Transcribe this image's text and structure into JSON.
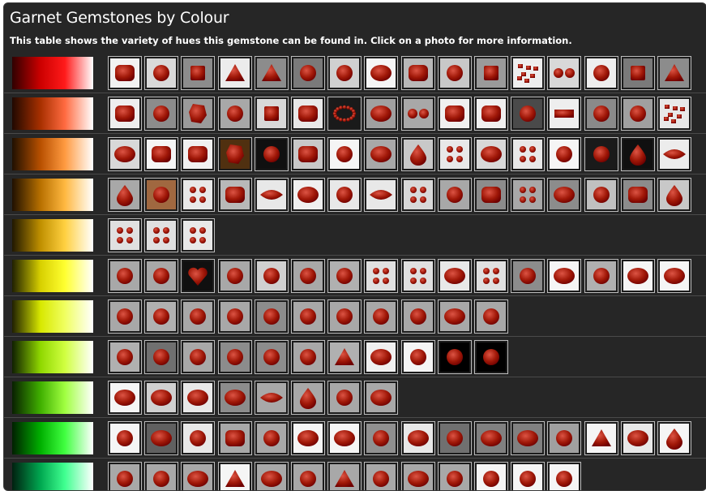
{
  "page": {
    "title": "Garnet Gemstones by Colour",
    "subtitle": "This table shows the variety of hues this gemstone can be found in. Click on a photo for more information."
  },
  "rows": [
    {
      "name": "red",
      "gradient": [
        "#300000",
        "#cc0000",
        "#ff1a1a",
        "#ffffff"
      ],
      "gems": [
        {
          "c": "#a01808",
          "s": "cushion",
          "bg": "#f2f2f2"
        },
        {
          "c": "#8a1a1a",
          "s": "round",
          "bg": "#d9d9d9"
        },
        {
          "c": "#a02010",
          "s": "square",
          "bg": "#8c8c8c"
        },
        {
          "c": "#6a0808",
          "s": "trillion",
          "bg": "#ececec"
        },
        {
          "c": "#8c1a10",
          "s": "trillion",
          "bg": "#8c8c8c"
        },
        {
          "c": "#b01010",
          "s": "round",
          "bg": "#7a7a7a"
        },
        {
          "c": "#a01818",
          "s": "round",
          "bg": "#d0d0d0"
        },
        {
          "c": "#b00808",
          "s": "oval",
          "bg": "#f5f5f5"
        },
        {
          "c": "#a81010",
          "s": "cushion",
          "bg": "#b8b8b8"
        },
        {
          "c": "#a01818",
          "s": "round",
          "bg": "#c8c8c8"
        },
        {
          "c": "#b01818",
          "s": "square",
          "bg": "#9a9a9a"
        },
        {
          "c": "#c02828",
          "s": "cluster",
          "bg": "#eeeeee"
        },
        {
          "c": "#b01818",
          "s": "pair",
          "bg": "#d8d8d8"
        },
        {
          "c": "#c03838",
          "s": "round",
          "bg": "#eeeeee"
        },
        {
          "c": "#901010",
          "s": "square",
          "bg": "#7a7a7a"
        },
        {
          "c": "#a01010",
          "s": "trillion",
          "bg": "#8c8c8c"
        }
      ]
    },
    {
      "name": "red-orange",
      "gradient": [
        "#200800",
        "#a83000",
        "#ff6a40",
        "#ffffff"
      ],
      "gems": [
        {
          "c": "#c83818",
          "s": "cushion",
          "bg": "#eeeeee"
        },
        {
          "c": "#f07810",
          "s": "round",
          "bg": "#8c8c8c"
        },
        {
          "c": "#c85820",
          "s": "rough",
          "bg": "#9a9a9a"
        },
        {
          "c": "#e04810",
          "s": "round",
          "bg": "#a8a8a8"
        },
        {
          "c": "#b83010",
          "s": "square",
          "bg": "#d8d8d8"
        },
        {
          "c": "#c01828",
          "s": "cushion",
          "bg": "#e8e8e8"
        },
        {
          "c": "#e86818",
          "s": "necklace",
          "bg": "#1a1a1a"
        },
        {
          "c": "#b03810",
          "s": "oval",
          "bg": "#a0a0a0"
        },
        {
          "c": "#c03818",
          "s": "pair",
          "bg": "#a8a8a8"
        },
        {
          "c": "#d83020",
          "s": "cushion",
          "bg": "#f0f0f0"
        },
        {
          "c": "#f07038",
          "s": "cushion",
          "bg": "#f0f0f0"
        },
        {
          "c": "#a83010",
          "s": "round",
          "bg": "#4a4a4a"
        },
        {
          "c": "#d04818",
          "s": "bar",
          "bg": "#eeeeee"
        },
        {
          "c": "#903018",
          "s": "round",
          "bg": "#8a8a8a"
        },
        {
          "c": "#a04020",
          "s": "round",
          "bg": "#a0a0a0"
        },
        {
          "c": "#d04020",
          "s": "cluster",
          "bg": "#e8e8e8"
        }
      ]
    },
    {
      "name": "orange",
      "gradient": [
        "#201000",
        "#b85000",
        "#ff9a40",
        "#ffffff"
      ],
      "gems": [
        {
          "c": "#5a6a98",
          "s": "oval",
          "bg": "#d8d8d8"
        },
        {
          "c": "#d86018",
          "s": "cushion",
          "bg": "#f5f5f5"
        },
        {
          "c": "#c85810",
          "s": "cushion",
          "bg": "#f0f0f0"
        },
        {
          "c": "#b07018",
          "s": "rough",
          "bg": "#503010"
        },
        {
          "c": "#a08818",
          "s": "round",
          "bg": "#101010"
        },
        {
          "c": "#e0a070",
          "s": "cushion",
          "bg": "#c8c8c8"
        },
        {
          "c": "#a09038",
          "s": "round",
          "bg": "#f5f5f5"
        },
        {
          "c": "#d07010",
          "s": "oval",
          "bg": "#a8a8a8"
        },
        {
          "c": "#e86010",
          "s": "pear",
          "bg": "#c8c8c8"
        },
        {
          "c": "#d08060",
          "s": "grid",
          "bg": "#e8e8e8"
        },
        {
          "c": "#708018",
          "s": "oval",
          "bg": "#d8d8d8"
        },
        {
          "c": "#e0a090",
          "s": "grid",
          "bg": "#e8e8e8"
        },
        {
          "c": "#e07810",
          "s": "round",
          "bg": "#f5f5f5"
        },
        {
          "c": "#d06010",
          "s": "round",
          "bg": "#1a1a1a"
        },
        {
          "c": "#e06010",
          "s": "pear",
          "bg": "#101010"
        },
        {
          "c": "#f0a070",
          "s": "marquise",
          "bg": "#ececec"
        }
      ]
    },
    {
      "name": "yellow-orange",
      "gradient": [
        "#201000",
        "#b87000",
        "#ffb840",
        "#ffffff"
      ],
      "gems": [
        {
          "c": "#e0a070",
          "s": "pear",
          "bg": "#a8a8a8"
        },
        {
          "c": "#e08040",
          "s": "round",
          "bg": "#a06840"
        },
        {
          "c": "#e0a030",
          "s": "grid",
          "bg": "#e8e8e8"
        },
        {
          "c": "#e89010",
          "s": "cushion",
          "bg": "#b8b8b8"
        },
        {
          "c": "#f0b070",
          "s": "marquise",
          "bg": "#e8e8e8"
        },
        {
          "c": "#f0b860",
          "s": "oval",
          "bg": "#f0f0f0"
        },
        {
          "c": "#f09010",
          "s": "round",
          "bg": "#e8e8e8"
        },
        {
          "c": "#f0a050",
          "s": "marquise",
          "bg": "#e8e8e8"
        },
        {
          "c": "#c08040",
          "s": "grid",
          "bg": "#d8d8d8"
        },
        {
          "c": "#d09040",
          "s": "round",
          "bg": "#a8a8a8"
        },
        {
          "c": "#e08810",
          "s": "cushion",
          "bg": "#8c8c8c"
        },
        {
          "c": "#c07820",
          "s": "grid",
          "bg": "#a8a8a8"
        },
        {
          "c": "#e0a020",
          "s": "oval",
          "bg": "#8c8c8c"
        },
        {
          "c": "#e89838",
          "s": "round",
          "bg": "#c0c0c0"
        },
        {
          "c": "#e87810",
          "s": "cushion",
          "bg": "#8c8c8c"
        },
        {
          "c": "#e09030",
          "s": "pear",
          "bg": "#c8c8c8"
        }
      ]
    },
    {
      "name": "amber",
      "gradient": [
        "#201800",
        "#c09000",
        "#ffd040",
        "#ffffff"
      ],
      "gems": [
        {
          "c": "#d09010",
          "s": "grid",
          "bg": "#e0e0e0"
        },
        {
          "c": "#d07820",
          "s": "grid",
          "bg": "#e0e0e0"
        },
        {
          "c": "#d08030",
          "s": "grid",
          "bg": "#e8e8e8"
        }
      ]
    },
    {
      "name": "yellow",
      "gradient": [
        "#202000",
        "#d8d000",
        "#ffff30",
        "#ffffff"
      ],
      "gems": [
        {
          "c": "#a0a060",
          "s": "round",
          "bg": "#a8a8a8"
        },
        {
          "c": "#b0a860",
          "s": "round",
          "bg": "#a8a8a8"
        },
        {
          "c": "#d8b840",
          "s": "heart",
          "bg": "#101010"
        },
        {
          "c": "#c0b870",
          "s": "round",
          "bg": "#a8a8a8"
        },
        {
          "c": "#c0b870",
          "s": "round",
          "bg": "#d0d0d0"
        },
        {
          "c": "#c8c080",
          "s": "round",
          "bg": "#a8a8a8"
        },
        {
          "c": "#b0a860",
          "s": "round",
          "bg": "#b0b0b0"
        },
        {
          "c": "#d0a050",
          "s": "grid",
          "bg": "#e0e0e0"
        },
        {
          "c": "#d09030",
          "s": "grid",
          "bg": "#e0e0e0"
        },
        {
          "c": "#c0c070",
          "s": "oval",
          "bg": "#e8e8e8"
        },
        {
          "c": "#d09030",
          "s": "grid",
          "bg": "#e0e0e0"
        },
        {
          "c": "#a0a060",
          "s": "round",
          "bg": "#8c8c8c"
        },
        {
          "c": "#b8b040",
          "s": "oval",
          "bg": "#f5f5f5"
        },
        {
          "c": "#a8a850",
          "s": "round",
          "bg": "#b0b0b0"
        },
        {
          "c": "#c0b840",
          "s": "oval",
          "bg": "#f5f5f5"
        },
        {
          "c": "#c0c060",
          "s": "oval",
          "bg": "#f5f5f5"
        }
      ]
    },
    {
      "name": "lemon",
      "gradient": [
        "#202000",
        "#d8e800",
        "#f0ff60",
        "#ffffff"
      ],
      "gems": [
        {
          "c": "#c8c880",
          "s": "round",
          "bg": "#a8a8a8"
        },
        {
          "c": "#c8c878",
          "s": "round",
          "bg": "#b0b0b0"
        },
        {
          "c": "#b0b040",
          "s": "round",
          "bg": "#a8a8a8"
        },
        {
          "c": "#c8c880",
          "s": "round",
          "bg": "#a8a8a8"
        },
        {
          "c": "#b8b870",
          "s": "round",
          "bg": "#8c8c8c"
        },
        {
          "c": "#c0c080",
          "s": "round",
          "bg": "#a8a8a8"
        },
        {
          "c": "#c8c890",
          "s": "round",
          "bg": "#a8a8a8"
        },
        {
          "c": "#b0b070",
          "s": "round",
          "bg": "#a8a8a8"
        },
        {
          "c": "#c0c080",
          "s": "round",
          "bg": "#a8a8a8"
        },
        {
          "c": "#c8c070",
          "s": "oval",
          "bg": "#a8a8a8"
        },
        {
          "c": "#c8c890",
          "s": "round",
          "bg": "#a8a8a8"
        }
      ]
    },
    {
      "name": "yellow-green",
      "gradient": [
        "#102000",
        "#90d800",
        "#d0ff40",
        "#ffffff"
      ],
      "gems": [
        {
          "c": "#a0b060",
          "s": "round",
          "bg": "#b0b0b0"
        },
        {
          "c": "#80a018",
          "s": "round",
          "bg": "#707070"
        },
        {
          "c": "#90a860",
          "s": "round",
          "bg": "#a8a8a8"
        },
        {
          "c": "#909850",
          "s": "round",
          "bg": "#8c8c8c"
        },
        {
          "c": "#a0a058",
          "s": "round",
          "bg": "#8c8c8c"
        },
        {
          "c": "#a8b870",
          "s": "round",
          "bg": "#a8a8a8"
        },
        {
          "c": "#80a020",
          "s": "trillion",
          "bg": "#b0b0b0"
        },
        {
          "c": "#c0c890",
          "s": "oval",
          "bg": "#f0f0f0"
        },
        {
          "c": "#a8a890",
          "s": "round",
          "bg": "#f5f5f5"
        },
        {
          "c": "#d0d8a0",
          "s": "round",
          "bg": "#000000"
        },
        {
          "c": "#d8e0b0",
          "s": "round",
          "bg": "#000000"
        }
      ]
    },
    {
      "name": "lime",
      "gradient": [
        "#082000",
        "#40b000",
        "#a0ff40",
        "#ffffff"
      ],
      "gems": [
        {
          "c": "#40a010",
          "s": "oval",
          "bg": "#f5f5f5"
        },
        {
          "c": "#208010",
          "s": "oval",
          "bg": "#d0d0d0"
        },
        {
          "c": "#a0b880",
          "s": "oval",
          "bg": "#e8e8e8"
        },
        {
          "c": "#30a018",
          "s": "oval",
          "bg": "#8c8c8c"
        },
        {
          "c": "#a0b078",
          "s": "marquise",
          "bg": "#a8a8a8"
        },
        {
          "c": "#80a050",
          "s": "pear",
          "bg": "#a8a8a8"
        },
        {
          "c": "#90b070",
          "s": "round",
          "bg": "#a8a8a8"
        },
        {
          "c": "#40a010",
          "s": "oval",
          "bg": "#a8a8a8"
        }
      ]
    },
    {
      "name": "green",
      "gradient": [
        "#002000",
        "#00b000",
        "#40ff40",
        "#ffffff"
      ],
      "gems": [
        {
          "c": "#108020",
          "s": "round",
          "bg": "#f5f5f5"
        },
        {
          "c": "#208040",
          "s": "oval",
          "bg": "#606060"
        },
        {
          "c": "#108018",
          "s": "round",
          "bg": "#e8e8e8"
        },
        {
          "c": "#208030",
          "s": "cushion",
          "bg": "#a8a8a8"
        },
        {
          "c": "#40a040",
          "s": "round",
          "bg": "#a8a8a8"
        },
        {
          "c": "#108018",
          "s": "oval",
          "bg": "#f5f5f5"
        },
        {
          "c": "#108020",
          "s": "oval",
          "bg": "#f5f5f5"
        },
        {
          "c": "#70a070",
          "s": "round",
          "bg": "#909090"
        },
        {
          "c": "#108830",
          "s": "oval",
          "bg": "#e8e8e8"
        },
        {
          "c": "#107028",
          "s": "round",
          "bg": "#707070"
        },
        {
          "c": "#107020",
          "s": "oval",
          "bg": "#808080"
        },
        {
          "c": "#208040",
          "s": "oval",
          "bg": "#808080"
        },
        {
          "c": "#208830",
          "s": "round",
          "bg": "#a0a0a0"
        },
        {
          "c": "#109030",
          "s": "trillion",
          "bg": "#f5f5f5"
        },
        {
          "c": "#208040",
          "s": "oval",
          "bg": "#e8e8e8"
        },
        {
          "c": "#107820",
          "s": "pear",
          "bg": "#f5f5f5"
        }
      ]
    },
    {
      "name": "emerald",
      "gradient": [
        "#002010",
        "#00a850",
        "#40ff90",
        "#ffffff"
      ],
      "gems": [
        {
          "c": "#30a060",
          "s": "round",
          "bg": "#a8a8a8"
        },
        {
          "c": "#108020",
          "s": "round",
          "bg": "#a8a8a8"
        },
        {
          "c": "#40a060",
          "s": "oval",
          "bg": "#a8a8a8"
        },
        {
          "c": "#203020",
          "s": "trillion",
          "bg": "#f5f5f5"
        },
        {
          "c": "#30a050",
          "s": "oval",
          "bg": "#a8a8a8"
        },
        {
          "c": "#20a050",
          "s": "round",
          "bg": "#a8a8a8"
        },
        {
          "c": "#20a060",
          "s": "trillion",
          "bg": "#a8a8a8"
        },
        {
          "c": "#208040",
          "s": "round",
          "bg": "#a8a8a8"
        },
        {
          "c": "#60b080",
          "s": "oval",
          "bg": "#a8a8a8"
        },
        {
          "c": "#30a050",
          "s": "round",
          "bg": "#a8a8a8"
        },
        {
          "c": "#10a040",
          "s": "round",
          "bg": "#f5f5f5"
        },
        {
          "c": "#108040",
          "s": "round",
          "bg": "#f5f5f5"
        },
        {
          "c": "#108040",
          "s": "round",
          "bg": "#f5f5f5"
        }
      ]
    }
  ],
  "colors": {
    "panel": "#262626",
    "text": "#ffffff",
    "rowDivider": "#4a4a4a",
    "thumbBorder": "#bdbdbd"
  }
}
